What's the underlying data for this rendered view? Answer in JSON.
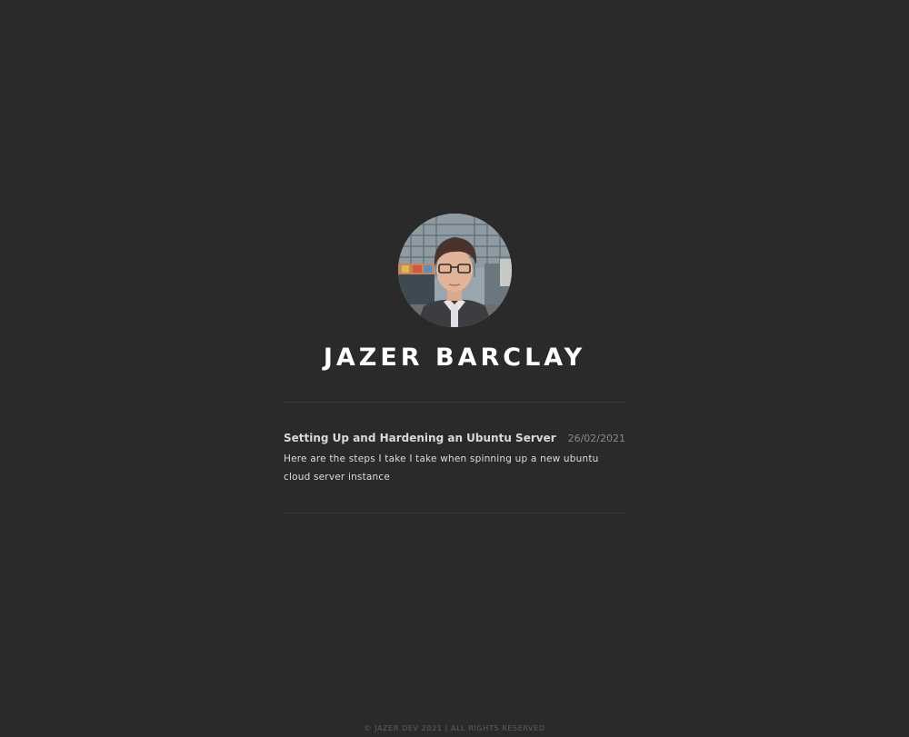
{
  "profile": {
    "avatar_icon": "profile-photo",
    "name": "JAZER BARCLAY"
  },
  "posts": [
    {
      "title": "Setting Up and Hardening an Ubuntu Server",
      "date": "26/02/2021",
      "description": "Here are the steps I take I take when spinning up a new ubuntu cloud server instance"
    }
  ],
  "footer": {
    "text": "© JAZER DEV 2021 | ALL RIGHTS RESERVED"
  },
  "colors": {
    "background": "#2a2a2a",
    "name": "#ffffff",
    "title": "#d9d9d9",
    "date": "#8a8a8a",
    "divider": "#3a3a3a",
    "footer": "#5f5f5f"
  }
}
